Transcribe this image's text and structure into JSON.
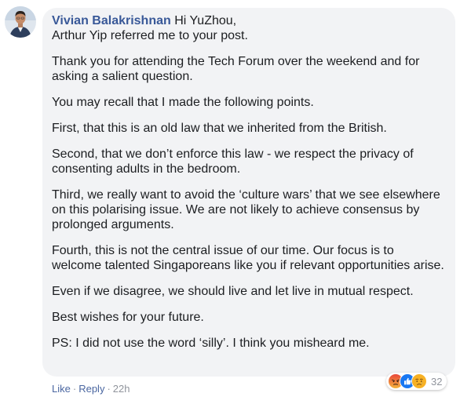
{
  "comment": {
    "author": "Vivian Balakrishnan",
    "greeting": "Hi YuZhou,",
    "lines": [
      "Arthur Yip referred me to your post.",
      "Thank you for attending the Tech Forum over the weekend and for asking a salient question.",
      "You may recall that I made the following points.",
      "First, that this is an old law that we inherited from the British.",
      "Second, that we don’t enforce this law - we respect the privacy of consenting adults in the bedroom.",
      "Third, we really want to avoid the ‘culture wars’ that we see elsewhere on this polarising issue. We are not likely to achieve consensus by prolonged arguments.",
      "Fourth, this is not the central issue of our time. Our focus is to welcome talented Singaporeans like you if relevant opportunities arise.",
      "Even if we disagree, we should live and let live in mutual respect.",
      "Best wishes for your future.",
      "PS: I did not use the word ‘silly’. I think you misheard me."
    ]
  },
  "actions": {
    "like": "Like",
    "reply": "Reply",
    "separator": "·",
    "time": "22h"
  },
  "reactions": {
    "icons": [
      "angry-icon",
      "like-icon",
      "sad-icon"
    ],
    "count": "32"
  },
  "colors": {
    "bubble": "#f2f3f5",
    "author": "#385898",
    "link": "#4b67a1",
    "meta": "#90949c",
    "like": "#1877f2",
    "angry": "#e9710f",
    "sad": "#f7b125"
  }
}
